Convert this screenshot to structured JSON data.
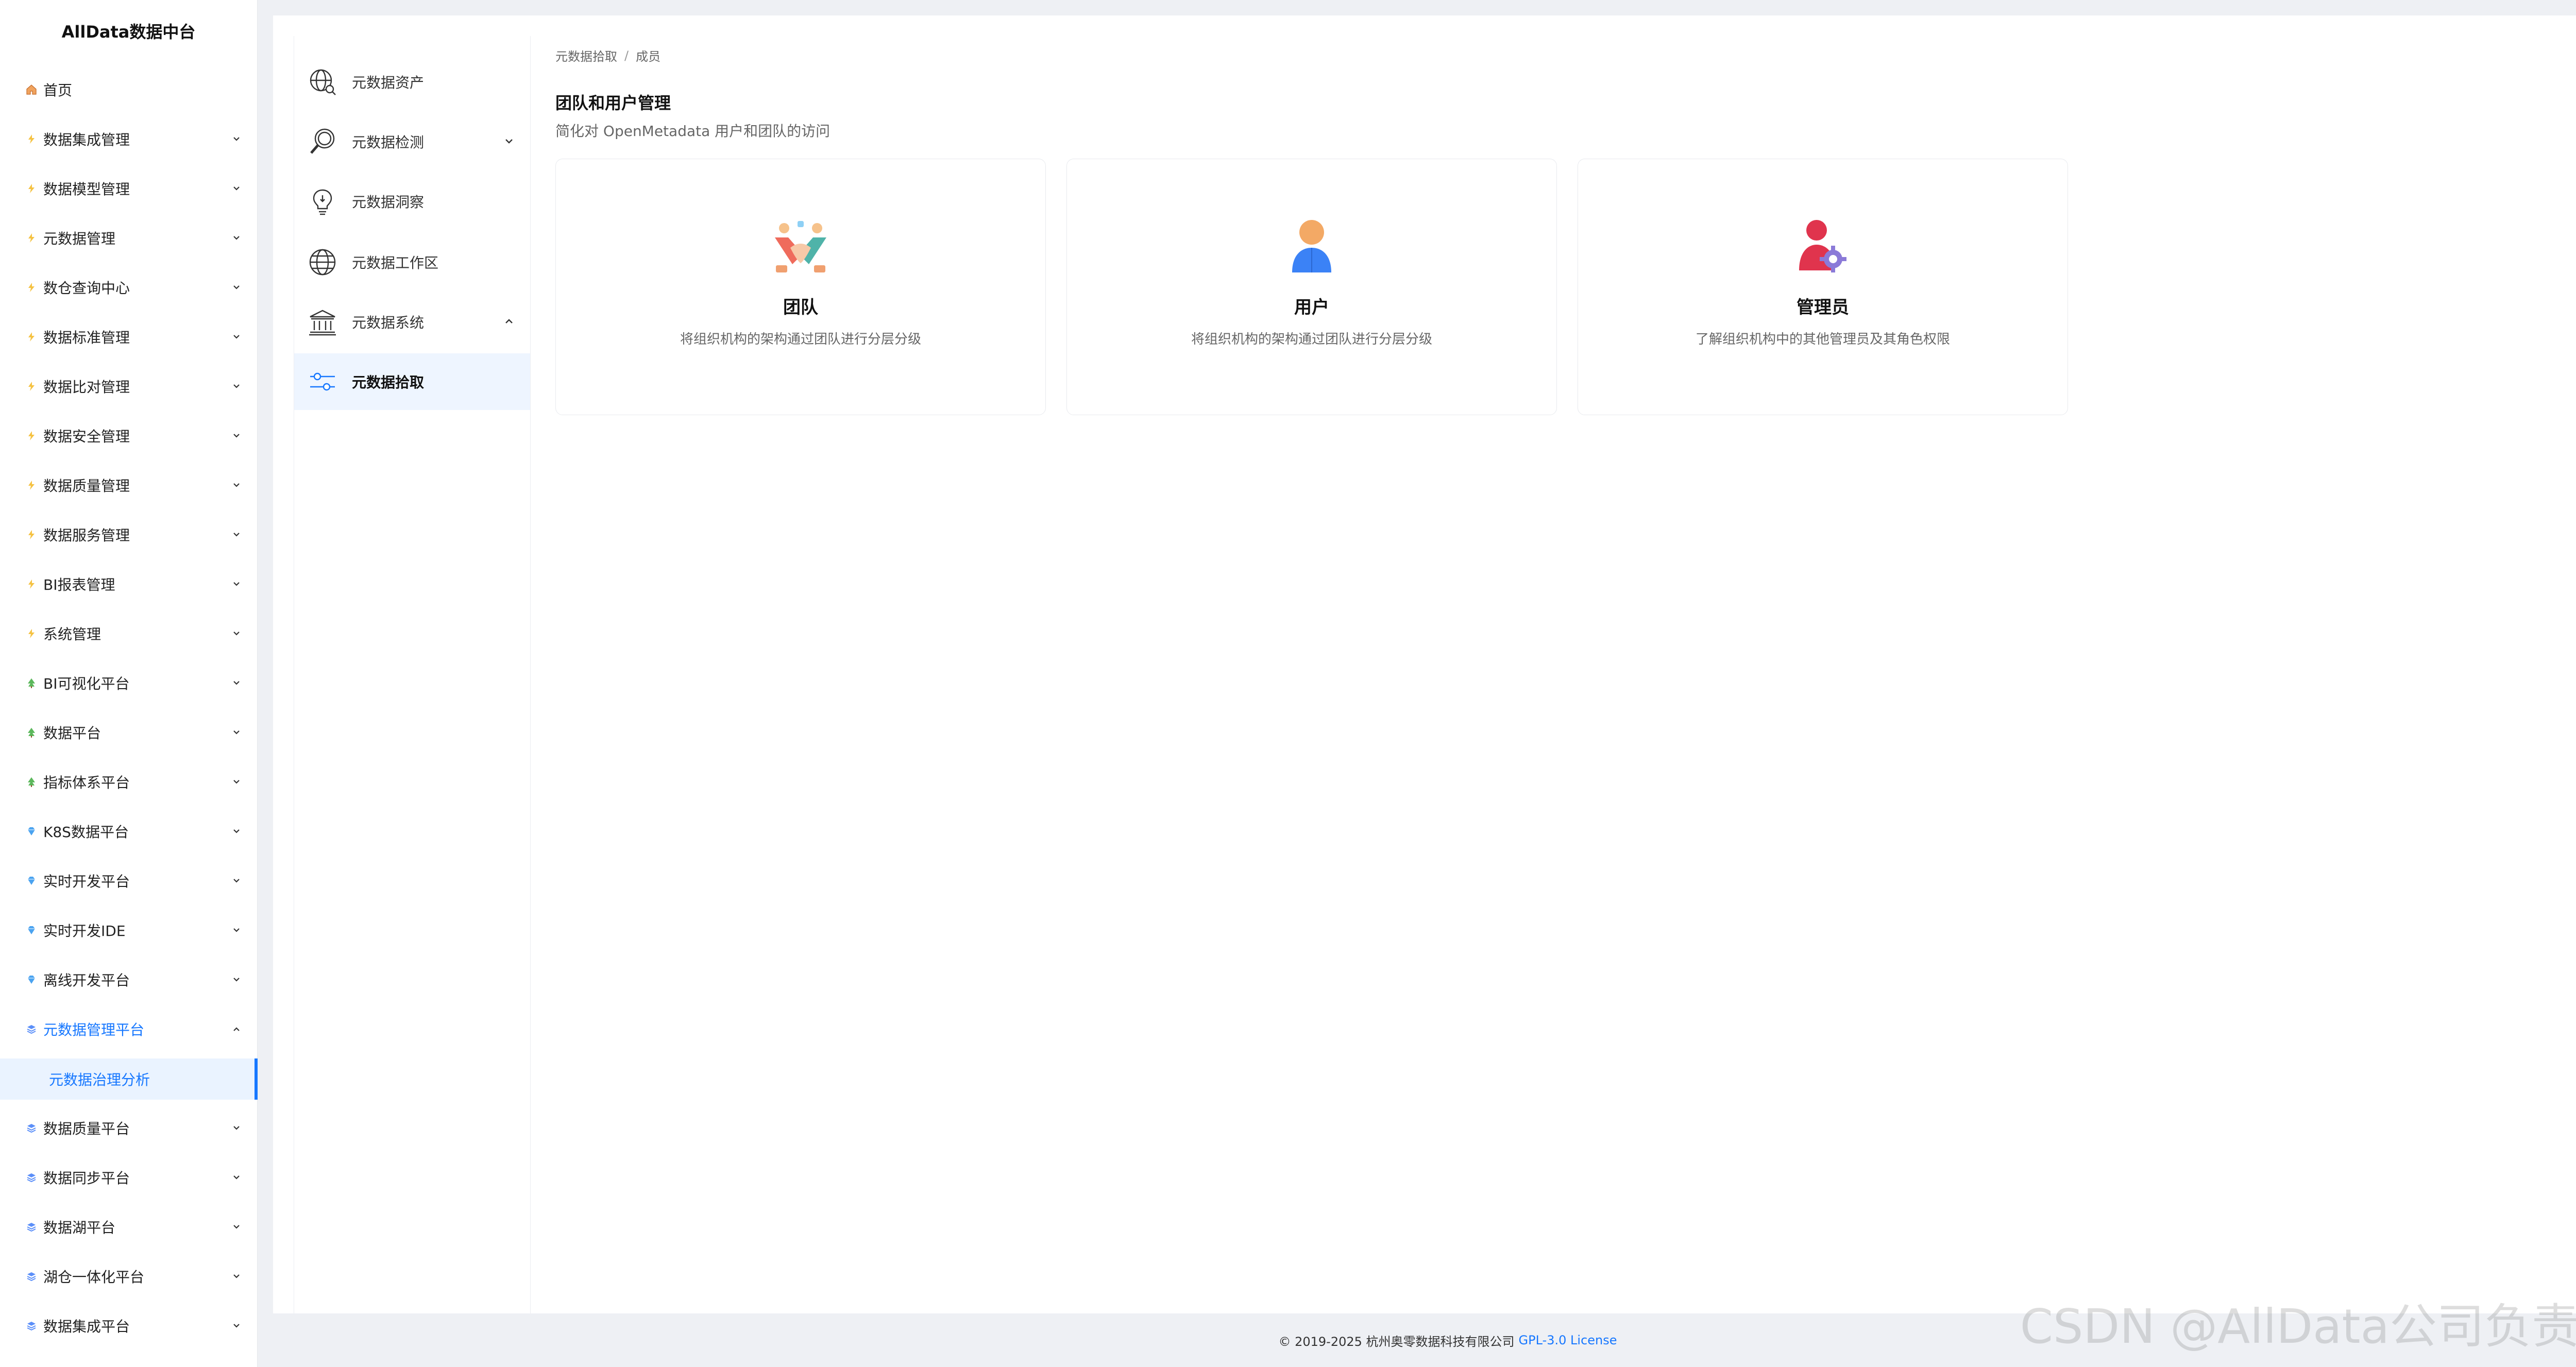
{
  "brand": {
    "title": "AllData数据中台"
  },
  "sidebar": {
    "home": {
      "label": "首页"
    },
    "items": [
      {
        "label": "数据集成管理",
        "icon": "bolt-icon"
      },
      {
        "label": "数据模型管理",
        "icon": "bolt-icon"
      },
      {
        "label": "元数据管理",
        "icon": "bolt-icon"
      },
      {
        "label": "数仓查询中心",
        "icon": "bolt-icon"
      },
      {
        "label": "数据标准管理",
        "icon": "bolt-icon"
      },
      {
        "label": "数据比对管理",
        "icon": "bolt-icon"
      },
      {
        "label": "数据安全管理",
        "icon": "bolt-icon"
      },
      {
        "label": "数据质量管理",
        "icon": "bolt-icon"
      },
      {
        "label": "数据服务管理",
        "icon": "bolt-icon"
      },
      {
        "label": "BI报表管理",
        "icon": "bolt-icon"
      },
      {
        "label": "系统管理",
        "icon": "bolt-icon"
      },
      {
        "label": "BI可视化平台",
        "icon": "tree-icon"
      },
      {
        "label": "数据平台",
        "icon": "tree-icon"
      },
      {
        "label": "指标体系平台",
        "icon": "tree-icon"
      },
      {
        "label": "K8S数据平台",
        "icon": "gem-icon"
      },
      {
        "label": "实时开发平台",
        "icon": "gem-icon"
      },
      {
        "label": "实时开发IDE",
        "icon": "gem-icon"
      },
      {
        "label": "离线开发平台",
        "icon": "gem-icon"
      },
      {
        "label": "元数据管理平台",
        "icon": "stack-icon"
      },
      {
        "label": "数据质量平台",
        "icon": "stack-icon"
      },
      {
        "label": "数据同步平台",
        "icon": "stack-icon"
      },
      {
        "label": "数据湖平台",
        "icon": "stack-icon"
      },
      {
        "label": "湖仓一体化平台",
        "icon": "stack-icon"
      },
      {
        "label": "数据集成平台",
        "icon": "stack-icon"
      }
    ],
    "active_sub": {
      "label": "元数据治理分析"
    }
  },
  "sub_sidebar": {
    "items": [
      {
        "label": "元数据资产",
        "icon": "globe-search-icon"
      },
      {
        "label": "元数据检测",
        "icon": "magnifier-icon"
      },
      {
        "label": "元数据洞察",
        "icon": "lightbulb-icon"
      },
      {
        "label": "元数据工作区",
        "icon": "globe-icon"
      },
      {
        "label": "元数据系统",
        "icon": "bank-icon"
      },
      {
        "label": "元数据拾取",
        "icon": "sliders-icon"
      }
    ]
  },
  "breadcrumb": {
    "part1": "元数据拾取",
    "separator": "/",
    "part2": "成员"
  },
  "page": {
    "title": "团队和用户管理",
    "subtitle": "简化对 OpenMetadata 用户和团队的访问"
  },
  "cards": [
    {
      "title": "团队",
      "desc": "将组织机构的架构通过团队进行分层分级",
      "icon": "team-handshake-icon"
    },
    {
      "title": "用户",
      "desc": "将组织机构的架构通过团队进行分层分级",
      "icon": "user-icon"
    },
    {
      "title": "管理员",
      "desc": "了解组织机构中的其他管理员及其角色权限",
      "icon": "admin-gear-icon"
    }
  ],
  "footer": {
    "copyright": "© 2019-2025 杭州奥零数据科技有限公司",
    "license": "GPL-3.0 License"
  },
  "watermark": "CSDN @AllData公司负责人",
  "colors": {
    "accent": "#1677ff",
    "active_bg": "#eaf3ff",
    "bolt": "#f5c242",
    "stack": "#5b8ff9"
  }
}
